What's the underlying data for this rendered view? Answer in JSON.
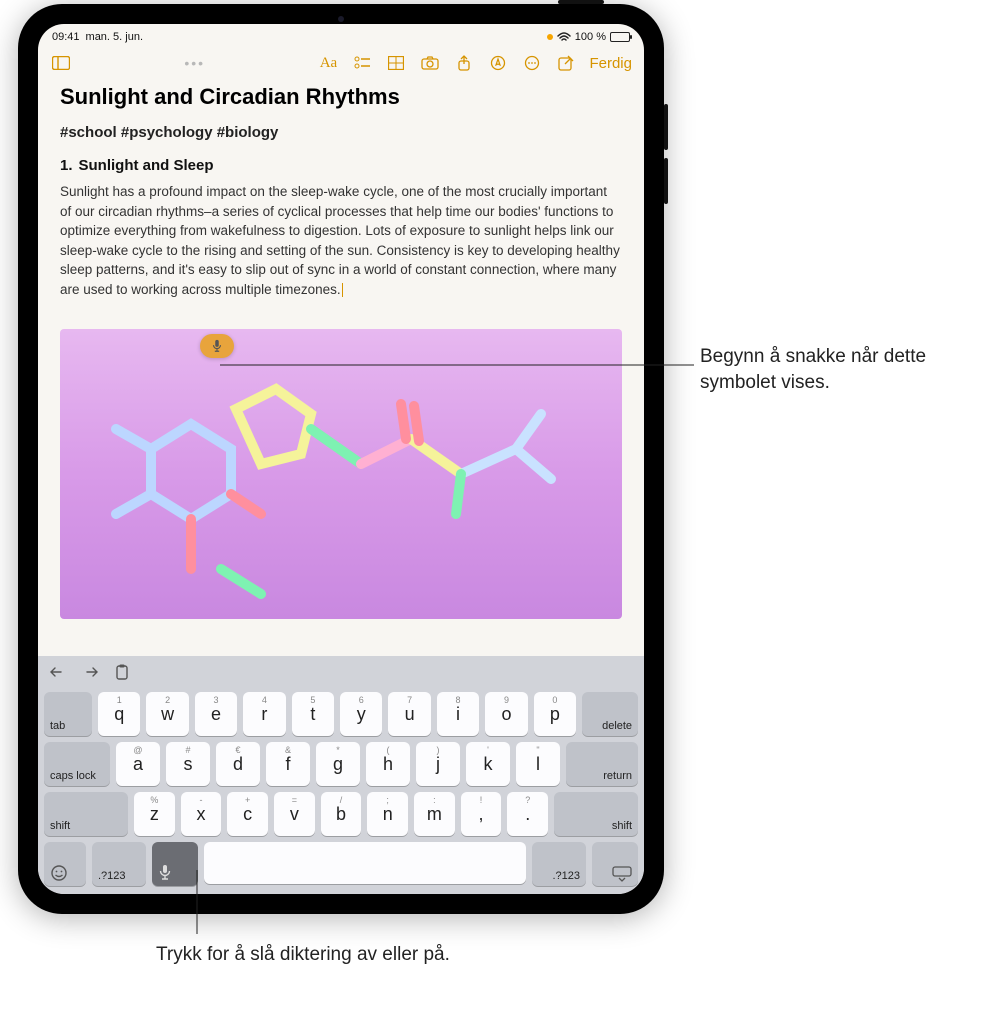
{
  "status": {
    "time": "09:41",
    "date": "man. 5. jun.",
    "battery_pct": "100 %",
    "battery_fill": 100
  },
  "toolbar": {
    "done_label": "Ferdig"
  },
  "note": {
    "title": "Sunlight and Circadian Rhythms",
    "tags": "#school #psychology #biology",
    "heading_number": "1.",
    "heading_text": "Sunlight and Sleep",
    "body": "Sunlight has a profound impact on the sleep-wake cycle, one of the most crucially important of our circadian rhythms–a series of cyclical processes that help time our bodies' functions to optimize everything from wakefulness to digestion. Lots of exposure to sunlight helps link our sleep-wake cycle to the rising and setting of the sun. Consistency is key to developing healthy sleep patterns, and it's easy to slip out of sync in a world of constant connection, where many are used to working across multiple timezones."
  },
  "keyboard": {
    "row1_sub": [
      "1",
      "2",
      "3",
      "4",
      "5",
      "6",
      "7",
      "8",
      "9",
      "0"
    ],
    "row1": [
      "q",
      "w",
      "e",
      "r",
      "t",
      "y",
      "u",
      "i",
      "o",
      "p"
    ],
    "row2_sub": [
      "@",
      "#",
      "€",
      "&",
      "*",
      "(",
      ")",
      "'",
      "\""
    ],
    "row2": [
      "a",
      "s",
      "d",
      "f",
      "g",
      "h",
      "j",
      "k",
      "l"
    ],
    "row3_sub": [
      "%",
      "-",
      "+",
      "=",
      "/",
      ";",
      ":",
      "!",
      "?"
    ],
    "row3": [
      "z",
      "x",
      "c",
      "v",
      "b",
      "n",
      "m",
      ",",
      "."
    ],
    "tab": "tab",
    "caps": "caps lock",
    "shift": "shift",
    "delete": "delete",
    "return": "return",
    "numsym": ".?123"
  },
  "callouts": {
    "c1": "Begynn å snakke når dette symbolet vises.",
    "c2": "Trykk for å slå diktering av eller på."
  }
}
